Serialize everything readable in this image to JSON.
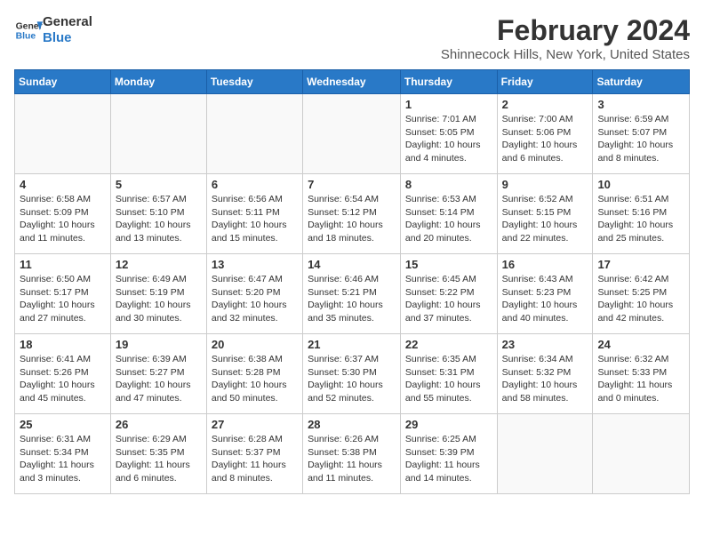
{
  "logo": {
    "line1": "General",
    "line2": "Blue"
  },
  "title": "February 2024",
  "subtitle": "Shinnecock Hills, New York, United States",
  "headers": [
    "Sunday",
    "Monday",
    "Tuesday",
    "Wednesday",
    "Thursday",
    "Friday",
    "Saturday"
  ],
  "weeks": [
    [
      {
        "day": "",
        "info": ""
      },
      {
        "day": "",
        "info": ""
      },
      {
        "day": "",
        "info": ""
      },
      {
        "day": "",
        "info": ""
      },
      {
        "day": "1",
        "info": "Sunrise: 7:01 AM\nSunset: 5:05 PM\nDaylight: 10 hours\nand 4 minutes."
      },
      {
        "day": "2",
        "info": "Sunrise: 7:00 AM\nSunset: 5:06 PM\nDaylight: 10 hours\nand 6 minutes."
      },
      {
        "day": "3",
        "info": "Sunrise: 6:59 AM\nSunset: 5:07 PM\nDaylight: 10 hours\nand 8 minutes."
      }
    ],
    [
      {
        "day": "4",
        "info": "Sunrise: 6:58 AM\nSunset: 5:09 PM\nDaylight: 10 hours\nand 11 minutes."
      },
      {
        "day": "5",
        "info": "Sunrise: 6:57 AM\nSunset: 5:10 PM\nDaylight: 10 hours\nand 13 minutes."
      },
      {
        "day": "6",
        "info": "Sunrise: 6:56 AM\nSunset: 5:11 PM\nDaylight: 10 hours\nand 15 minutes."
      },
      {
        "day": "7",
        "info": "Sunrise: 6:54 AM\nSunset: 5:12 PM\nDaylight: 10 hours\nand 18 minutes."
      },
      {
        "day": "8",
        "info": "Sunrise: 6:53 AM\nSunset: 5:14 PM\nDaylight: 10 hours\nand 20 minutes."
      },
      {
        "day": "9",
        "info": "Sunrise: 6:52 AM\nSunset: 5:15 PM\nDaylight: 10 hours\nand 22 minutes."
      },
      {
        "day": "10",
        "info": "Sunrise: 6:51 AM\nSunset: 5:16 PM\nDaylight: 10 hours\nand 25 minutes."
      }
    ],
    [
      {
        "day": "11",
        "info": "Sunrise: 6:50 AM\nSunset: 5:17 PM\nDaylight: 10 hours\nand 27 minutes."
      },
      {
        "day": "12",
        "info": "Sunrise: 6:49 AM\nSunset: 5:19 PM\nDaylight: 10 hours\nand 30 minutes."
      },
      {
        "day": "13",
        "info": "Sunrise: 6:47 AM\nSunset: 5:20 PM\nDaylight: 10 hours\nand 32 minutes."
      },
      {
        "day": "14",
        "info": "Sunrise: 6:46 AM\nSunset: 5:21 PM\nDaylight: 10 hours\nand 35 minutes."
      },
      {
        "day": "15",
        "info": "Sunrise: 6:45 AM\nSunset: 5:22 PM\nDaylight: 10 hours\nand 37 minutes."
      },
      {
        "day": "16",
        "info": "Sunrise: 6:43 AM\nSunset: 5:23 PM\nDaylight: 10 hours\nand 40 minutes."
      },
      {
        "day": "17",
        "info": "Sunrise: 6:42 AM\nSunset: 5:25 PM\nDaylight: 10 hours\nand 42 minutes."
      }
    ],
    [
      {
        "day": "18",
        "info": "Sunrise: 6:41 AM\nSunset: 5:26 PM\nDaylight: 10 hours\nand 45 minutes."
      },
      {
        "day": "19",
        "info": "Sunrise: 6:39 AM\nSunset: 5:27 PM\nDaylight: 10 hours\nand 47 minutes."
      },
      {
        "day": "20",
        "info": "Sunrise: 6:38 AM\nSunset: 5:28 PM\nDaylight: 10 hours\nand 50 minutes."
      },
      {
        "day": "21",
        "info": "Sunrise: 6:37 AM\nSunset: 5:30 PM\nDaylight: 10 hours\nand 52 minutes."
      },
      {
        "day": "22",
        "info": "Sunrise: 6:35 AM\nSunset: 5:31 PM\nDaylight: 10 hours\nand 55 minutes."
      },
      {
        "day": "23",
        "info": "Sunrise: 6:34 AM\nSunset: 5:32 PM\nDaylight: 10 hours\nand 58 minutes."
      },
      {
        "day": "24",
        "info": "Sunrise: 6:32 AM\nSunset: 5:33 PM\nDaylight: 11 hours\nand 0 minutes."
      }
    ],
    [
      {
        "day": "25",
        "info": "Sunrise: 6:31 AM\nSunset: 5:34 PM\nDaylight: 11 hours\nand 3 minutes."
      },
      {
        "day": "26",
        "info": "Sunrise: 6:29 AM\nSunset: 5:35 PM\nDaylight: 11 hours\nand 6 minutes."
      },
      {
        "day": "27",
        "info": "Sunrise: 6:28 AM\nSunset: 5:37 PM\nDaylight: 11 hours\nand 8 minutes."
      },
      {
        "day": "28",
        "info": "Sunrise: 6:26 AM\nSunset: 5:38 PM\nDaylight: 11 hours\nand 11 minutes."
      },
      {
        "day": "29",
        "info": "Sunrise: 6:25 AM\nSunset: 5:39 PM\nDaylight: 11 hours\nand 14 minutes."
      },
      {
        "day": "",
        "info": ""
      },
      {
        "day": "",
        "info": ""
      }
    ]
  ]
}
